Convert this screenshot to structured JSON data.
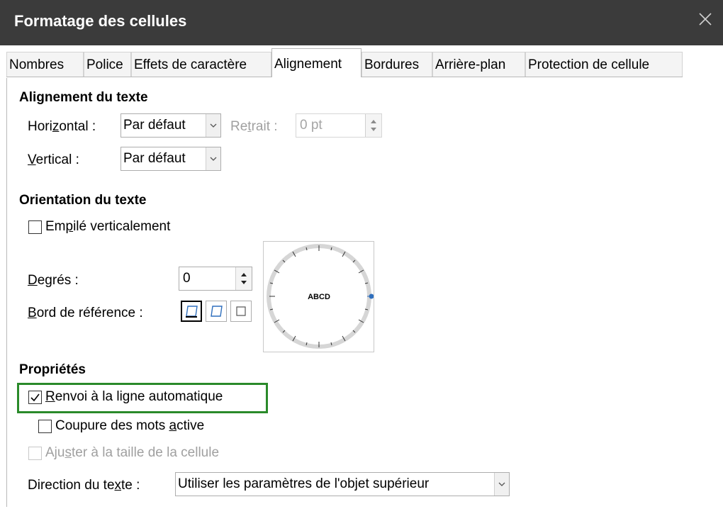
{
  "window": {
    "title": "Formatage des cellules"
  },
  "tabs": [
    "Nombres",
    "Police",
    "Effets de caractère",
    "Alignement",
    "Bordures",
    "Arrière-plan",
    "Protection de cellule"
  ],
  "active_tab": "Alignement",
  "text_alignment": {
    "heading": "Alignement du texte",
    "horizontal_pre": "Hori",
    "horizontal_u": "z",
    "horizontal_post": "ontal :",
    "horizontal_value": "Par défaut",
    "indent_pre": "Re",
    "indent_u": "t",
    "indent_post": "rait :",
    "indent_value": "0 pt",
    "vertical_u": "V",
    "vertical_post": "ertical :",
    "vertical_value": "Par défaut"
  },
  "text_orientation": {
    "heading": "Orientation du texte",
    "stacked_pre": "Em",
    "stacked_u": "p",
    "stacked_post": "ilé verticalement",
    "degrees_u": "D",
    "degrees_post": "egrés :",
    "degrees_value": "0",
    "reference_u": "B",
    "reference_post": "ord de référence :",
    "dial_label": "ABCD"
  },
  "properties": {
    "heading": "Propriétés",
    "wrap_u": "R",
    "wrap_post": "envoi à la ligne automatique",
    "wrap_checked": true,
    "hyphen_pre": "Coupure des mots ",
    "hyphen_u": "a",
    "hyphen_post": "ctive",
    "hyphen_checked": false,
    "shrink_pre": "Aju",
    "shrink_u": "s",
    "shrink_post": "ter à la taille de la cellule",
    "shrink_checked": false,
    "direction_pre": "Direction du te",
    "direction_u": "x",
    "direction_post": "te :",
    "direction_value": "Utiliser les paramètres de l'objet supérieur"
  },
  "colors": {
    "titlebar": "#3b3b3b",
    "highlight": "#2a8a2a",
    "accent": "#2f6fbd"
  }
}
